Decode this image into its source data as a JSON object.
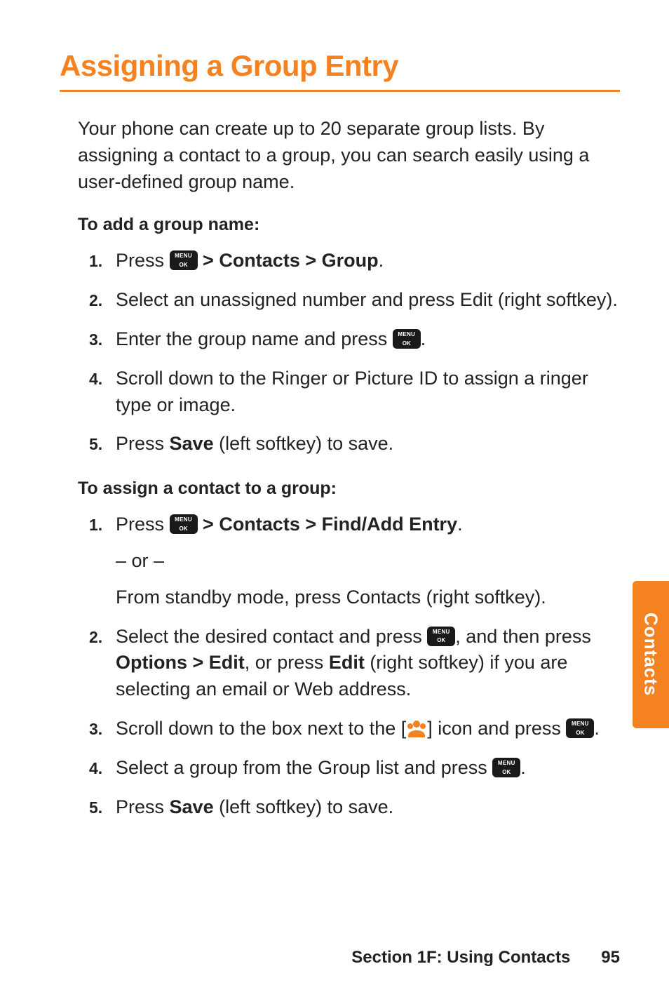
{
  "title": "Assigning a Group Entry",
  "intro": "Your phone can create up to 20 separate group lists. By assigning a contact to a group, you can search easily using a user-defined group name.",
  "subhead1": "To add a group name:",
  "steps1": {
    "s1_pre": "Press ",
    "s1_post": " > Contacts > Group",
    "s1_end": ".",
    "s2": "Select an unassigned number and press Edit (right softkey).",
    "s3_pre": "Enter the group name and press ",
    "s3_end": ".",
    "s4": "Scroll down to the Ringer or Picture ID to assign a ringer type or image.",
    "s5_pre": "Press ",
    "s5_bold": "Save",
    "s5_post": " (left softkey) to save."
  },
  "subhead2": "To assign a contact to a group:",
  "steps2": {
    "s1_pre": "Press ",
    "s1_post": " > Contacts > Find/Add Entry",
    "s1_end": ".",
    "s1_or": "– or –",
    "s1_alt": "From standby mode, press Contacts (right softkey).",
    "s2_pre": "Select the desired contact and press ",
    "s2_mid1": ", and then press ",
    "s2_bold1": "Options > Edit",
    "s2_mid2": ", or press ",
    "s2_bold2": "Edit",
    "s2_post": " (right softkey) if you are selecting an email or Web address.",
    "s3_pre": "Scroll down to the box next to the [",
    "s3_post": "] icon and press ",
    "s3_end": ".",
    "s4_pre": "Select a group from the Group list and press ",
    "s4_end": ".",
    "s5_pre": "Press ",
    "s5_bold": "Save",
    "s5_post": " (left softkey) to save."
  },
  "side_tab": "Contacts",
  "footer": {
    "section": "Section 1F: Using Contacts",
    "page": "95"
  },
  "nums": {
    "n1": "1.",
    "n2": "2.",
    "n3": "3.",
    "n4": "4.",
    "n5": "5."
  }
}
